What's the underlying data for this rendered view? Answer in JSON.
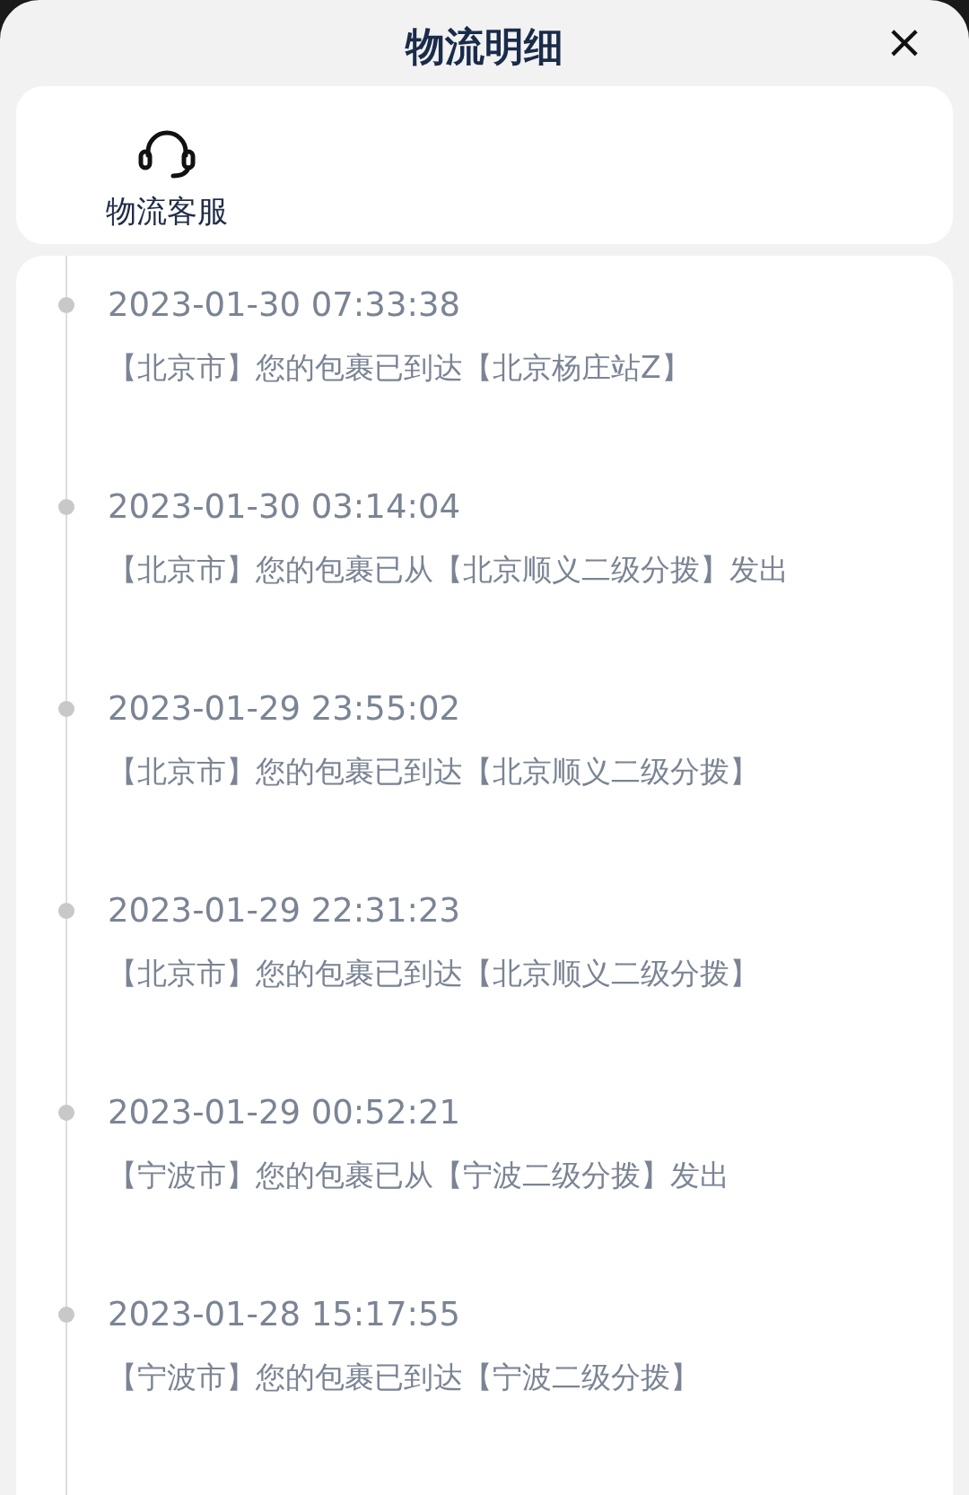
{
  "header": {
    "title": "物流明细",
    "close": "×"
  },
  "service": {
    "label": "物流客服"
  },
  "timeline": [
    {
      "time": "2023-01-30 07:33:38",
      "text": "【北京市】您的包裹已到达【北京杨庄站Z】"
    },
    {
      "time": "2023-01-30 03:14:04",
      "text": "【北京市】您的包裹已从【北京顺义二级分拨】发出"
    },
    {
      "time": "2023-01-29 23:55:02",
      "text": "【北京市】您的包裹已到达【北京顺义二级分拨】"
    },
    {
      "time": "2023-01-29 22:31:23",
      "text": "【北京市】您的包裹已到达【北京顺义二级分拨】"
    },
    {
      "time": "2023-01-29 00:52:21",
      "text": "【宁波市】您的包裹已从【宁波二级分拨】发出"
    },
    {
      "time": "2023-01-28 15:17:55",
      "text": "【宁波市】您的包裹已到达【宁波二级分拨】"
    }
  ]
}
